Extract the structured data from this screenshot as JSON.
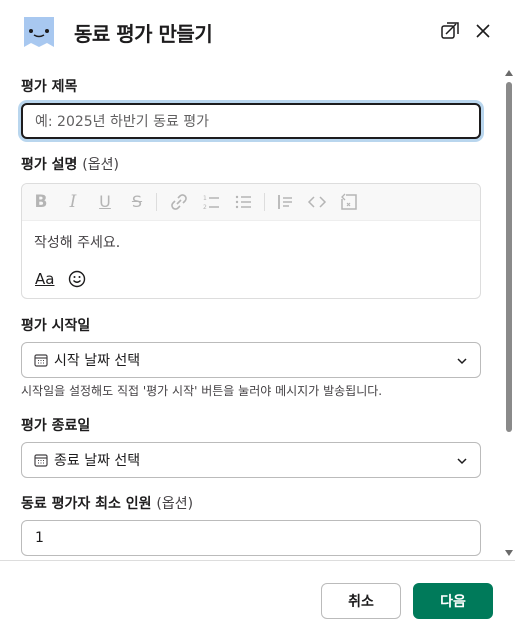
{
  "header": {
    "title": "동료 평가 만들기"
  },
  "form": {
    "title_label": "평가 제목",
    "title_placeholder": "예: 2025년 하반기 동료 평가",
    "desc_label": "평가 설명",
    "desc_optional": "(옵션)",
    "desc_placeholder": "작성해 주세요.",
    "format_label": "Aa",
    "start_label": "평가 시작일",
    "start_select": "시작 날짜 선택",
    "start_help": "시작일을 설정해도 직접 '평가 시작' 버튼을 눌러야 메시지가 발송됩니다.",
    "end_label": "평가 종료일",
    "end_select": "종료 날짜 선택",
    "min_label": "동료 평가자 최소 인원",
    "min_optional": "(옵션)",
    "min_value": "1"
  },
  "toolbar": {
    "items": [
      "bold-icon",
      "italic-icon",
      "underline-icon",
      "strikethrough-icon",
      "link-icon",
      "ordered-list-icon",
      "bulleted-list-icon",
      "blockquote-icon",
      "code-icon",
      "code-block-icon"
    ]
  },
  "footer": {
    "cancel_label": "취소",
    "next_label": "다음"
  },
  "colors": {
    "primary": "#007a5a",
    "focus_ring": "#b9d6ee",
    "app_icon": "#a8c8f0"
  }
}
